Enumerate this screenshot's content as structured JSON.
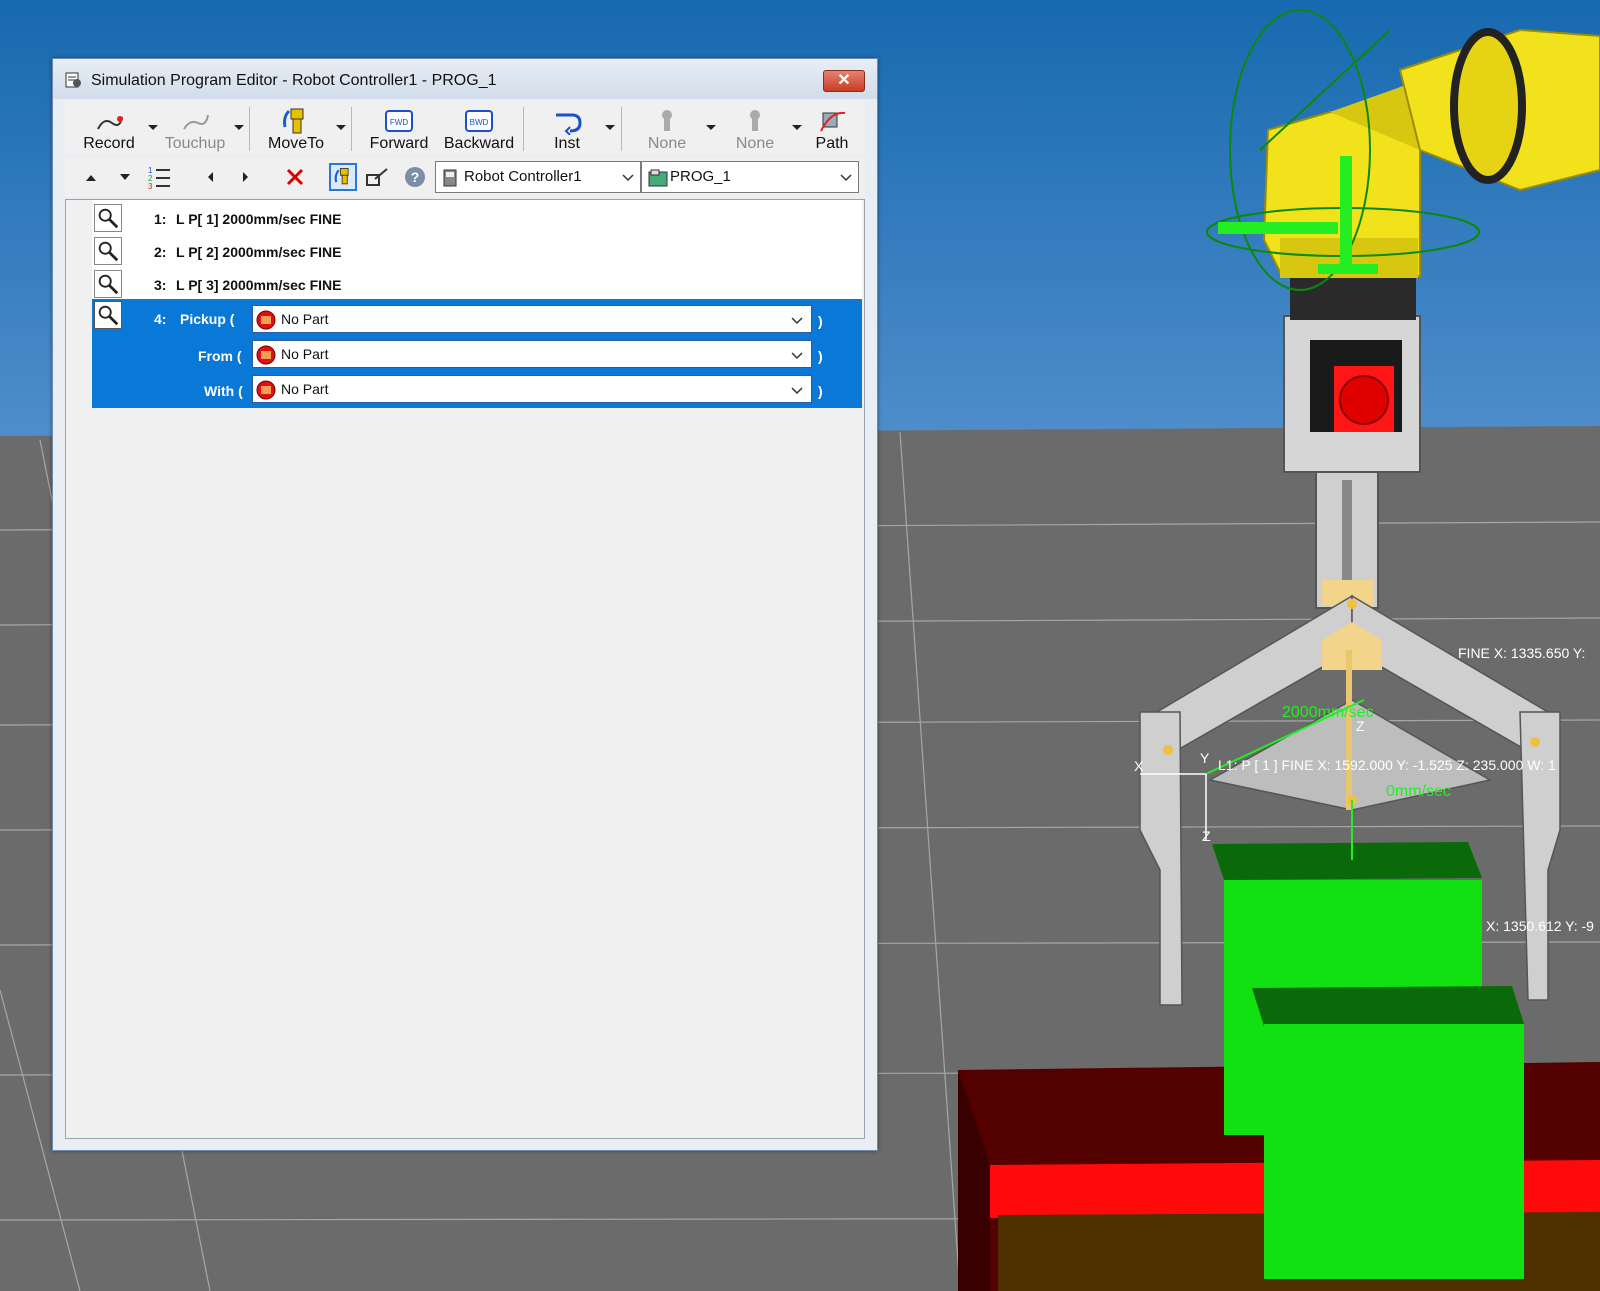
{
  "window": {
    "title": "Simulation Program Editor - Robot Controller1 - PROG_1",
    "close_glyph": "✕"
  },
  "toolbar": {
    "record": "Record",
    "touchup": "Touchup",
    "moveto": "MoveTo",
    "forward": "Forward",
    "backward": "Backward",
    "inst": "Inst",
    "none1": "None",
    "none2": "None",
    "path": "Path",
    "fwd_icon_text": "FWD",
    "bwd_icon_text": "BWD"
  },
  "selectors": {
    "controller": "Robot Controller1",
    "program": "PROG_1"
  },
  "program": {
    "lines": [
      {
        "num": "1:",
        "text": "L P[ 1] 2000mm/sec FINE"
      },
      {
        "num": "2:",
        "text": "L P[ 2] 2000mm/sec FINE"
      },
      {
        "num": "3:",
        "text": "L P[ 3] 2000mm/sec FINE"
      }
    ],
    "pickup": {
      "num": "4:",
      "pickup_kw": "Pickup (",
      "from_kw": "From (",
      "with_kw": "With (",
      "pickup_value": "No Part",
      "from_value": "No Part",
      "with_value": "No Part",
      "close_paren": ")"
    }
  },
  "scene_labels": {
    "fine_xy": "FINE X: 1335.650 Y:",
    "speed1": "2000mm/sec",
    "speed2": "0mm/sec",
    "pos_label": "L1: P [ 1 ]   FINE X: 1592.000 Y: -1.525 Z: 235.000 W: 1",
    "x_label": "X: 1350.612 Y: -9",
    "axis_x": "X",
    "axis_y": "Y",
    "axis_z": "Z",
    "axis_z2": "Z"
  },
  "colors": {
    "sky": "#1769b0",
    "floor": "#6b6b6b",
    "selection": "#0a78d7",
    "robot_yellow": "#f2e21c",
    "part_green": "#11e011"
  }
}
